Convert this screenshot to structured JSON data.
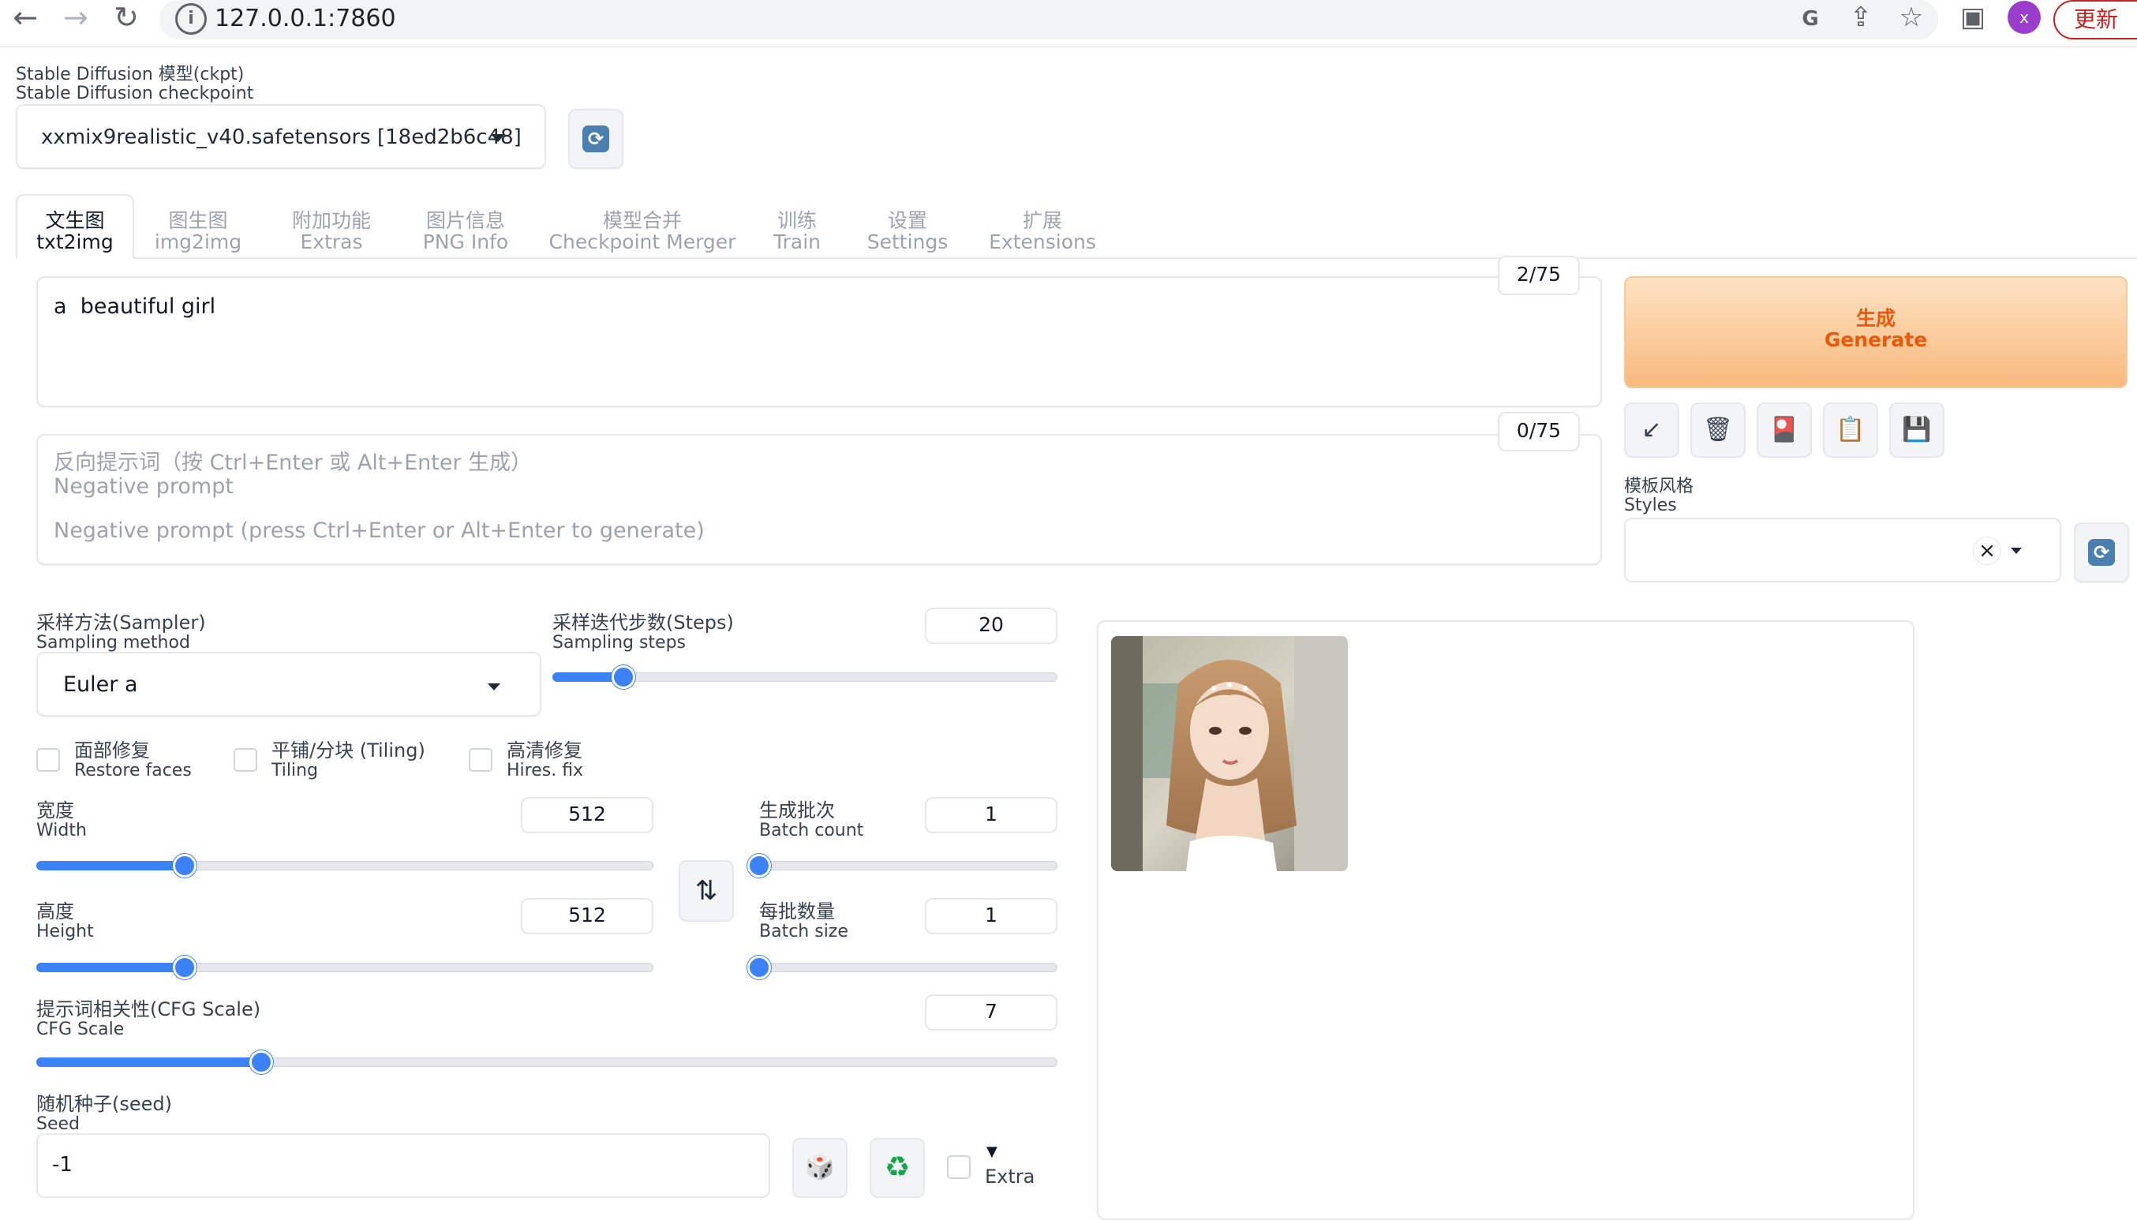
{
  "browser": {
    "url": "127.0.0.1:7860",
    "update_label": "更新",
    "avatar_letter": "x",
    "icons": [
      "back-arrow-icon",
      "forward-arrow-icon",
      "reload-icon",
      "info-icon",
      "translate-icon",
      "share-icon",
      "star-icon",
      "sidebar-icon"
    ]
  },
  "checkpoint": {
    "label_cn": "Stable Diffusion 模型(ckpt)",
    "label_en": "Stable Diffusion checkpoint",
    "value": "xxmix9realistic_v40.safetensors [18ed2b6c48]"
  },
  "tabs": [
    {
      "cn": "文生图",
      "en": "txt2img",
      "active": true
    },
    {
      "cn": "图生图",
      "en": "img2img",
      "active": false
    },
    {
      "cn": "附加功能",
      "en": "Extras",
      "active": false
    },
    {
      "cn": "图片信息",
      "en": "PNG Info",
      "active": false
    },
    {
      "cn": "模型合并",
      "en": "Checkpoint Merger",
      "active": false
    },
    {
      "cn": "训练",
      "en": "Train",
      "active": false
    },
    {
      "cn": "设置",
      "en": "Settings",
      "active": false
    },
    {
      "cn": "扩展",
      "en": "Extensions",
      "active": false
    }
  ],
  "prompt": {
    "value": "a  beautiful girl",
    "token_count": "2/75"
  },
  "negative_prompt": {
    "label_cn": "反向提示词（按 Ctrl+Enter 或 Alt+Enter 生成）",
    "label_en": "Negative prompt",
    "placeholder": "Negative prompt (press Ctrl+Enter or Alt+Enter to generate)",
    "token_count": "0/75"
  },
  "generate": {
    "label_cn": "生成",
    "label_en": "Generate"
  },
  "tool_buttons": [
    {
      "icon": "arrow-down-left-icon",
      "glyph": "↙"
    },
    {
      "icon": "trash-icon",
      "glyph": "🗑"
    },
    {
      "icon": "red-card-icon",
      "glyph": "🎴"
    },
    {
      "icon": "clipboard-icon",
      "glyph": "📋"
    },
    {
      "icon": "save-icon",
      "glyph": "💾"
    }
  ],
  "styles": {
    "label_cn": "模板风格",
    "label_en": "Styles",
    "clear_glyph": "×"
  },
  "sampler": {
    "label_cn": "采样方法(Sampler)",
    "label_en": "Sampling method",
    "value": "Euler a"
  },
  "steps": {
    "label_cn": "采样迭代步数(Steps)",
    "label_en": "Sampling steps",
    "value": "20",
    "fraction": 0.14
  },
  "checkboxes": [
    {
      "cn": "面部修复",
      "en": "Restore faces",
      "checked": false
    },
    {
      "cn": "平铺/分块 (Tiling)",
      "en": "Tiling",
      "checked": false
    },
    {
      "cn": "高清修复",
      "en": "Hires. fix",
      "checked": false
    }
  ],
  "width": {
    "label_cn": "宽度",
    "label_en": "Width",
    "value": "512",
    "fraction": 0.24
  },
  "height": {
    "label_cn": "高度",
    "label_en": "Height",
    "value": "512",
    "fraction": 0.24
  },
  "batch_count": {
    "label_cn": "生成批次",
    "label_en": "Batch count",
    "value": "1",
    "fraction": 0.0
  },
  "batch_size": {
    "label_cn": "每批数量",
    "label_en": "Batch size",
    "value": "1",
    "fraction": 0.0
  },
  "swap_glyph": "⇅",
  "cfg": {
    "label_cn": "提示词相关性(CFG Scale)",
    "label_en": "CFG Scale",
    "value": "7",
    "fraction": 0.22
  },
  "seed": {
    "label_cn": "随机种子(seed)",
    "label_en": "Seed",
    "value": "-1",
    "dice_glyph": "🎲",
    "recycle_glyph": "♻",
    "extra_label": "Extra",
    "extra_arrow": "▼"
  },
  "colors": {
    "accent": "#3b82f6",
    "generate_text": "#ea580c",
    "update": "#c5221f"
  }
}
